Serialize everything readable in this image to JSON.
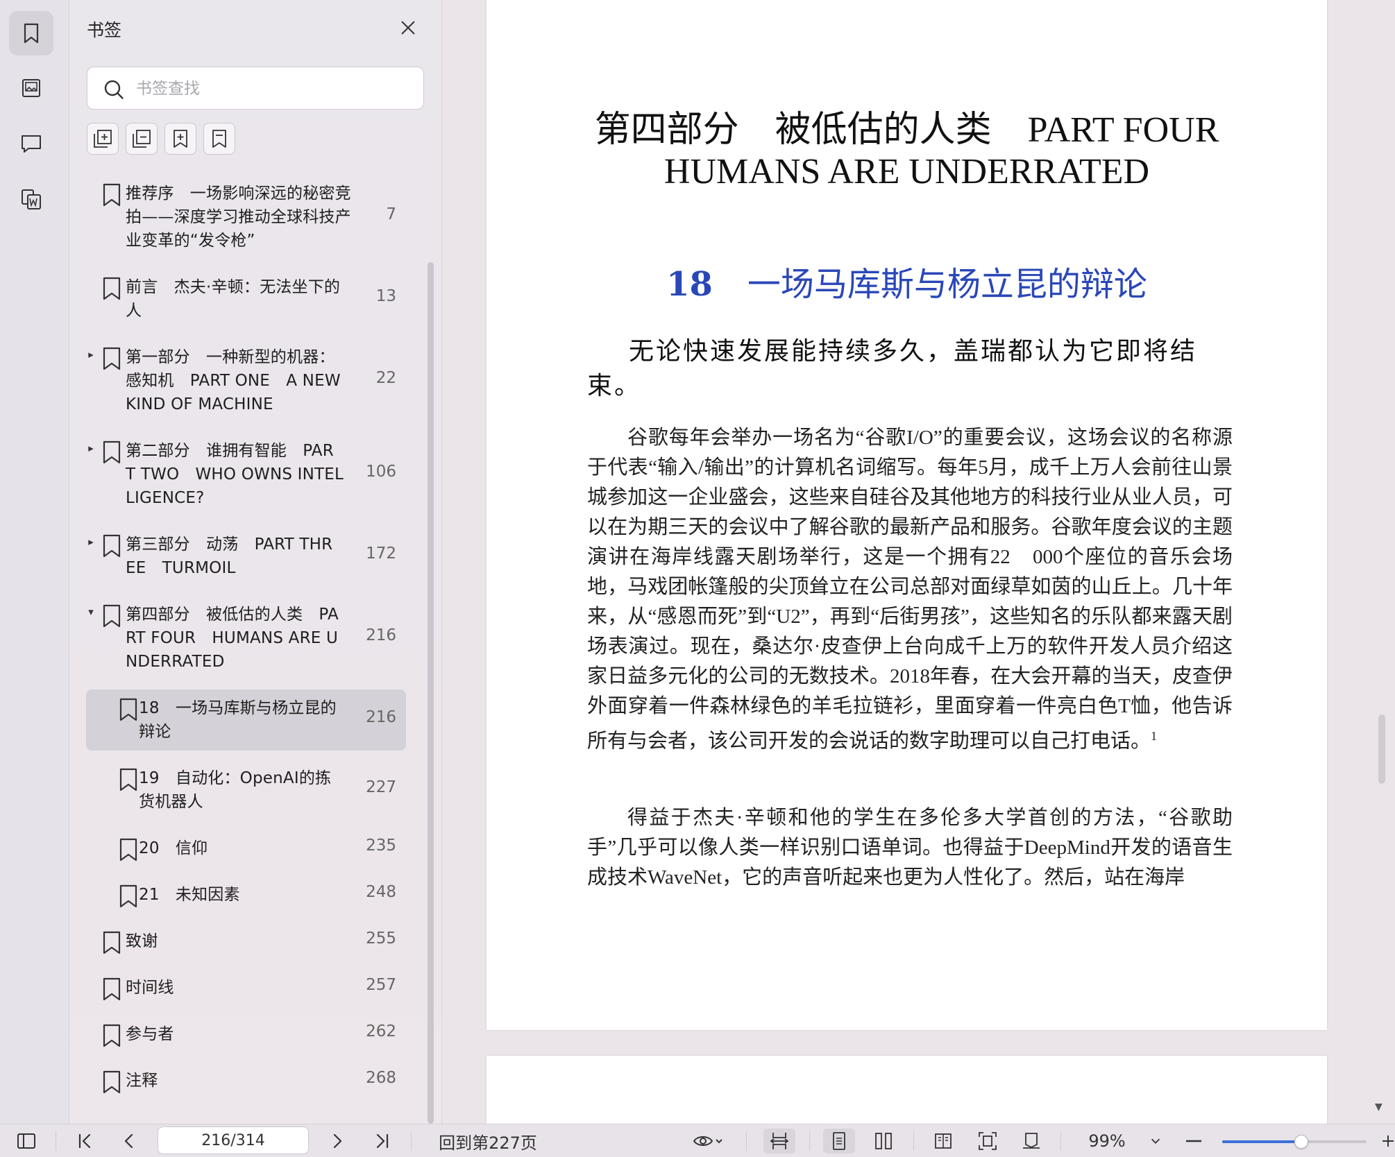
{
  "sidebar": {
    "title": "书签",
    "search_placeholder": "书签查找",
    "bookmarks": [
      {
        "label": "推荐序　一场影响深远的秘密竞拍——深度学习推动全球科技产业变革的“发令枪”",
        "lines": [
          "推荐序　一场影响深远的秘密竞",
          "拍——深度学习推动全球科技产",
          "业变革的“发令枪”"
        ],
        "page": "7"
      },
      {
        "label": "前言　杰夫·辛顿：无法坐下的人",
        "lines": [
          "前言　杰夫·辛顿：无法坐下的",
          "人"
        ],
        "page": "13"
      },
      {
        "label": "第一部分　一种新型的机器：感知机　PART ONE　A NEW KIND OF MACHINE",
        "lines": [
          "第一部分　一种新型的机器：",
          "感知机　PART ONE　A NEW",
          "KIND OF MACHINE"
        ],
        "page": "22",
        "arrow": "▸"
      },
      {
        "label": "第二部分　谁拥有智能　PART TWO　WHO OWNS INTELLIGENCE?",
        "lines": [
          "第二部分　谁拥有智能　PAR",
          "T TWO　WHO OWNS INTEL",
          "LIGENCE?"
        ],
        "page": "106",
        "arrow": "▸"
      },
      {
        "label": "第三部分　动荡　PART THREE　TURMOIL",
        "lines": [
          "第三部分　动荡　PART THR",
          "EE　TURMOIL"
        ],
        "page": "172",
        "arrow": "▸"
      },
      {
        "label": "第四部分　被低估的人类　PART FOUR　HUMANS ARE UNDERRATED",
        "lines": [
          "第四部分　被低估的人类　PA",
          "RT FOUR　HUMANS ARE U",
          "NDERRATED"
        ],
        "page": "216",
        "arrow": "▾"
      },
      {
        "label": "18　一场马库斯与杨立昆的辩论",
        "lines": [
          "18　一场马库斯与杨立昆的",
          "辩论"
        ],
        "page": "216",
        "selected": true
      },
      {
        "label": "19　自动化：OpenAI的拣货机器人",
        "lines": [
          "19　自动化：OpenAI的拣",
          "货机器人"
        ],
        "page": "227"
      },
      {
        "label": "20　信仰",
        "lines": [
          "20　信仰"
        ],
        "page": "235"
      },
      {
        "label": "21　未知因素",
        "lines": [
          "21　未知因素"
        ],
        "page": "248"
      },
      {
        "label": "致谢",
        "lines": [
          "致谢"
        ],
        "page": "255"
      },
      {
        "label": "时间线",
        "lines": [
          "时间线"
        ],
        "page": "257"
      },
      {
        "label": "参与者",
        "lines": [
          "参与者"
        ],
        "page": "262"
      },
      {
        "label": "注释",
        "lines": [
          "注释"
        ],
        "page": "268"
      }
    ]
  },
  "document": {
    "part_title_line1": "第四部分　被低估的人类　PART FOUR",
    "part_title_line2": "HUMANS ARE UNDERRATED",
    "chapter_number": "18",
    "chapter_title": "一场马库斯与杨立昆的辩论",
    "lead": "无论快速发展能持续多久，盖瑞都认为它即将结束。",
    "paragraph1": "谷歌每年会举办一场名为“谷歌I/O”的重要会议，这场会议的名称源于代表“输入/输出”的计算机名词缩写。每年5月，成千上万人会前往山景城参加这一企业盛会，这些来自硅谷及其他地方的科技行业从业人员，可以在为期三天的会议中了解谷歌的最新产品和服务。谷歌年度会议的主题演讲在海岸线露天剧场举行，这是一个拥有22　000个座位的音乐会场地，马戏团帐篷般的尖顶耸立在公司总部对面绿草如茵的山丘上。几十年来，从“感恩而死”到“U2”，再到“后街男孩”，这些知名的乐队都来露天剧场表演过。现在，桑达尔·皮查伊上台向成千上万的软件开发人员介绍这家日益多元化的公司的无数技术。2018年春，在大会开幕的当天，皮查伊外面穿着一件森林绿色的羊毛拉链衫，里面穿着一件亮白色T恤，他告诉所有与会者，该公司开发的会说话的数字助理可以自己打电话。",
    "footnote_ref": "1",
    "paragraph2": "得益于杰夫·辛顿和他的学生在多伦多大学首创的方法，“谷歌助手”几乎可以像人类一样识别口语单词。也得益于DeepMind开发的语音生成技术WaveNet，它的声音听起来也更为人性化了。然后，站在海岸"
  },
  "toolbar": {
    "page_value": "216/314",
    "back_to_page": "回到第227页",
    "zoom": "99%",
    "zoom_level": 0.55
  },
  "colors": {
    "chapter_title": "#2a47b8",
    "zoom_accent": "#3c6fd8"
  }
}
